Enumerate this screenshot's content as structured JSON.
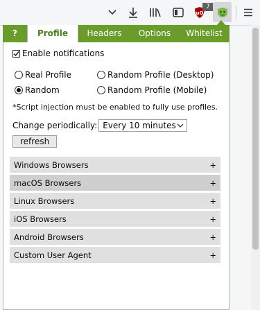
{
  "toolbar": {
    "icons": [
      "chevron-down-icon",
      "download-icon",
      "library-icon",
      "sidebar-icon",
      "ublock-icon",
      "user-agent-switcher-icon",
      "hamburger-menu-icon"
    ],
    "ublock_badge": "7"
  },
  "tabs": [
    {
      "label": "?"
    },
    {
      "label": "Profile"
    },
    {
      "label": "Headers"
    },
    {
      "label": "Options"
    },
    {
      "label": "Whitelist"
    }
  ],
  "profile": {
    "enable_notifications": "Enable notifications",
    "radio_real": "Real Profile",
    "radio_random_desktop": "Random Profile (Desktop)",
    "radio_random": "Random",
    "radio_random_mobile": "Random Profile (Mobile)",
    "note": "*Script injection must be enabled to fully use profiles.",
    "change_label": "Change periodically:",
    "change_value": "Every 10 minutes",
    "refresh_label": "refresh"
  },
  "sections": [
    {
      "label": "Windows Browsers",
      "toggle": "+"
    },
    {
      "label": "macOS Browsers",
      "toggle": "+"
    },
    {
      "label": "Linux Browsers",
      "toggle": "+"
    },
    {
      "label": "iOS Browsers",
      "toggle": "+"
    },
    {
      "label": "Android Browsers",
      "toggle": "+"
    },
    {
      "label": "Custom User Agent",
      "toggle": "+"
    }
  ],
  "colors": {
    "accent": "#6a9c2c",
    "section_bg": "#e0e0e0",
    "section_hover": "#cfcfcf"
  }
}
